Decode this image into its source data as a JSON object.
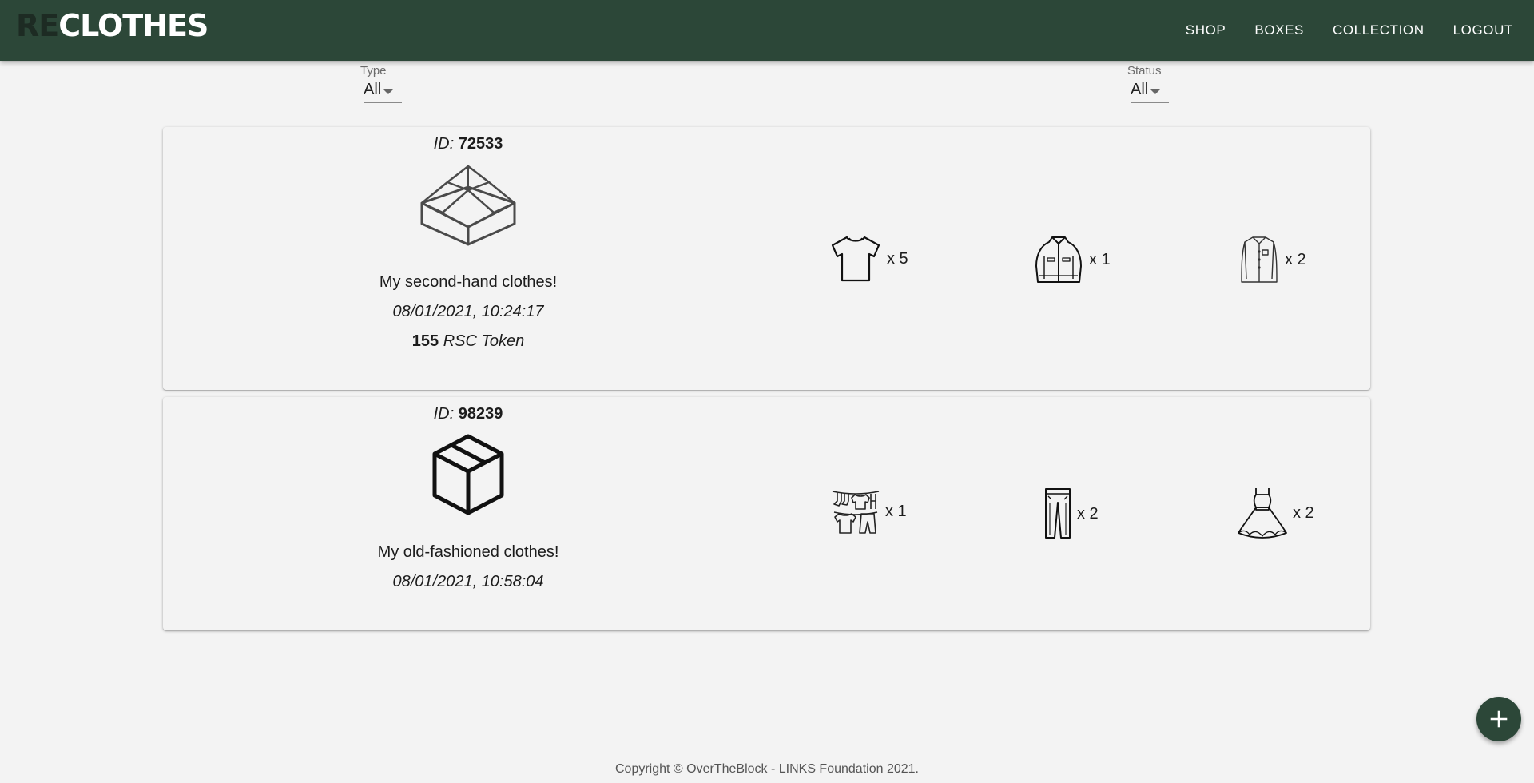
{
  "brand": {
    "logo_prefix": "RE",
    "logo_suffix": "CLOTHES"
  },
  "nav": [
    {
      "label": "SHOP"
    },
    {
      "label": "BOXES"
    },
    {
      "label": "COLLECTION"
    },
    {
      "label": "LOGOUT"
    }
  ],
  "filters": {
    "type": {
      "label": "Type",
      "value": "All"
    },
    "status": {
      "label": "Status",
      "value": "All"
    }
  },
  "boxes": [
    {
      "id_label": "ID:",
      "id": "72533",
      "icon": "open-box-icon",
      "name": "My second-hand clothes!",
      "date": "08/01/2021, 10:24:17",
      "token_amount": "155",
      "token_currency": "RSC Token",
      "items": [
        {
          "icon": "tshirt-icon",
          "qty": "x 5"
        },
        {
          "icon": "jacket-icon",
          "qty": "x 1"
        },
        {
          "icon": "shirt-icon",
          "qty": "x 2"
        }
      ]
    },
    {
      "id_label": "ID:",
      "id": "98239",
      "icon": "closed-box-icon",
      "name": "My old-fashioned clothes!",
      "date": "08/01/2021, 10:58:04",
      "items": [
        {
          "icon": "mixed-clothes-icon",
          "qty": "x 1"
        },
        {
          "icon": "trousers-icon",
          "qty": "x 2"
        },
        {
          "icon": "dress-icon",
          "qty": "x 2"
        }
      ]
    }
  ],
  "fab": {
    "icon": "plus-icon"
  },
  "footer": {
    "text": "Copyright © OverTheBlock - LINKS Foundation 2021."
  },
  "colors": {
    "primary": "#2c4738",
    "background": "#f3f3f3",
    "text": "#1c1c1c"
  }
}
